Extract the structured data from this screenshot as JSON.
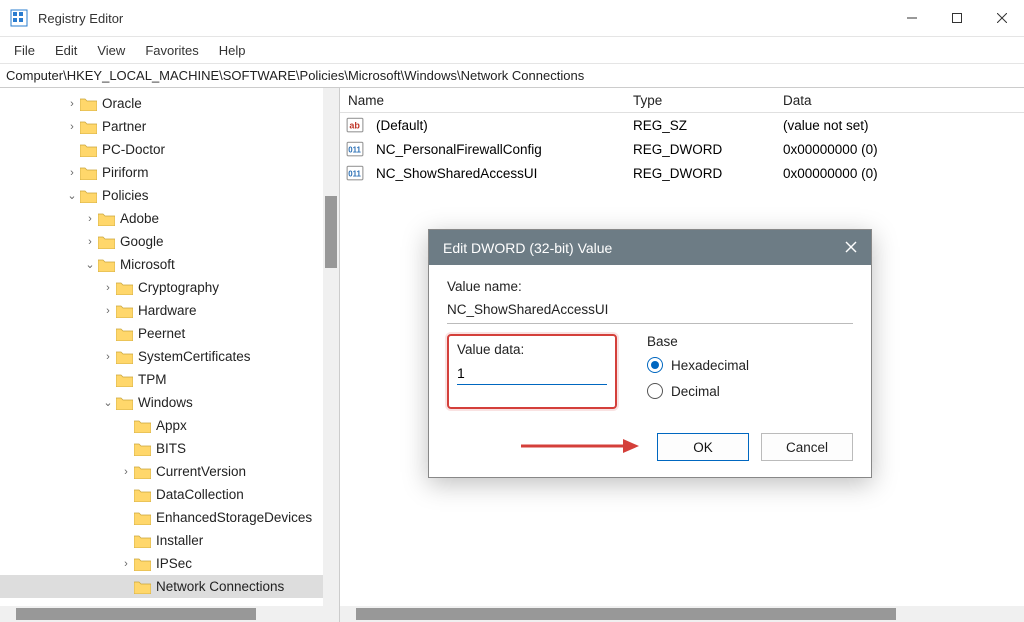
{
  "window": {
    "title": "Registry Editor"
  },
  "menu": {
    "file": "File",
    "edit": "Edit",
    "view": "View",
    "favorites": "Favorites",
    "help": "Help"
  },
  "address": "Computer\\HKEY_LOCAL_MACHINE\\SOFTWARE\\Policies\\Microsoft\\Windows\\Network Connections",
  "tree": {
    "oracle": "Oracle",
    "partner": "Partner",
    "pcdoctor": "PC-Doctor",
    "piriform": "Piriform",
    "policies": "Policies",
    "adobe": "Adobe",
    "google": "Google",
    "microsoft": "Microsoft",
    "crypto": "Cryptography",
    "hardware": "Hardware",
    "peernet": "Peernet",
    "syscerts": "SystemCertificates",
    "tpm": "TPM",
    "windows": "Windows",
    "appx": "Appx",
    "bits": "BITS",
    "curver": "CurrentVersion",
    "datacoll": "DataCollection",
    "enhstor": "EnhancedStorageDevices",
    "installer": "Installer",
    "ipsec": "IPSec",
    "netconn": "Network Connections"
  },
  "list": {
    "headers": {
      "name": "Name",
      "type": "Type",
      "data": "Data"
    },
    "rows": [
      {
        "name": "(Default)",
        "type": "REG_SZ",
        "data": "(value not set)"
      },
      {
        "name": "NC_PersonalFirewallConfig",
        "type": "REG_DWORD",
        "data": "0x00000000 (0)"
      },
      {
        "name": "NC_ShowSharedAccessUI",
        "type": "REG_DWORD",
        "data": "0x00000000 (0)"
      }
    ]
  },
  "dialog": {
    "title": "Edit DWORD (32-bit) Value",
    "value_name_label": "Value name:",
    "value_name": "NC_ShowSharedAccessUI",
    "value_data_label": "Value data:",
    "value_data": "1",
    "base_label": "Base",
    "hex": "Hexadecimal",
    "dec": "Decimal",
    "ok": "OK",
    "cancel": "Cancel"
  }
}
